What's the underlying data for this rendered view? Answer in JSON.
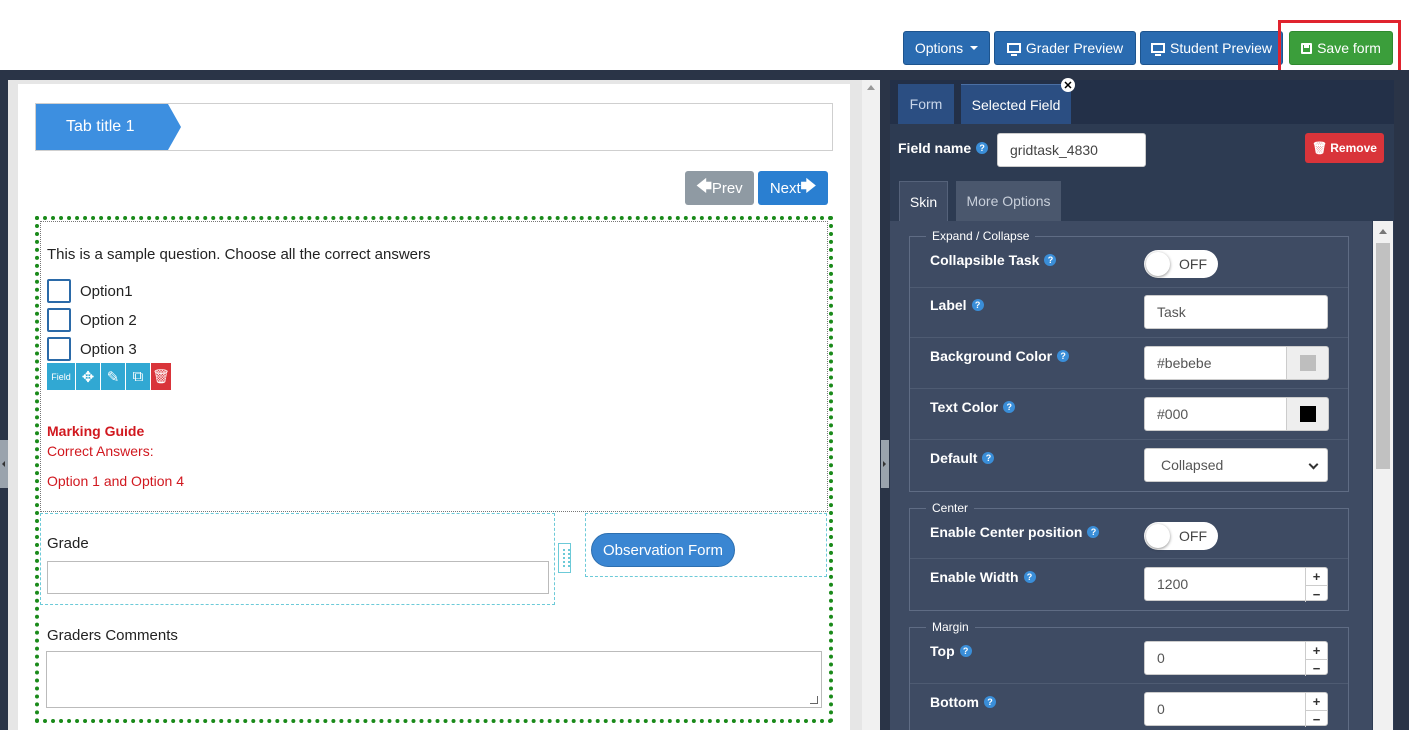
{
  "toolbar": {
    "options_label": "Options",
    "grader_preview_label": "Grader Preview",
    "student_preview_label": "Student Preview",
    "save_label": "Save form"
  },
  "canvas": {
    "tab_title": "Tab title 1",
    "prev_label": "Prev",
    "next_label": "Next",
    "question_text": "This is a sample question. Choose all the correct answers",
    "options": [
      "Option1",
      "Option 2",
      "Option 3"
    ],
    "field_toolbar_label": "Field",
    "marking_guide_title": "Marking Guide",
    "correct_answers_label": "Correct Answers:",
    "correct_answers_value": "Option 1 and Option 4",
    "grade_label": "Grade",
    "observation_form_label": "Observation Form",
    "graders_comments_label": "Graders Comments"
  },
  "panel": {
    "tab_form": "Form",
    "tab_selected_field": "Selected Field",
    "field_name_label": "Field name",
    "field_name_value": "gridtask_4830",
    "remove_label": "Remove",
    "subtab_skin": "Skin",
    "subtab_more_options": "More Options",
    "expand_collapse": {
      "legend": "Expand / Collapse",
      "collapsible_task_label": "Collapsible Task",
      "collapsible_task_state": "OFF",
      "label_label": "Label",
      "label_value": "Task",
      "background_color_label": "Background Color",
      "background_color_value": "#bebebe",
      "text_color_label": "Text Color",
      "text_color_value": "#000",
      "default_label": "Default",
      "default_value": "Collapsed"
    },
    "center": {
      "legend": "Center",
      "enable_center_label": "Enable Center position",
      "enable_center_state": "OFF",
      "enable_width_label": "Enable Width",
      "enable_width_value": "1200"
    },
    "margin": {
      "legend": "Margin",
      "top_label": "Top",
      "top_value": "0",
      "bottom_label": "Bottom",
      "bottom_value": "0"
    }
  },
  "colors": {
    "background_swatch": "#bebebe",
    "text_swatch": "#000000",
    "save_button": "#3b9e3b",
    "remove_button": "#d9343a"
  }
}
